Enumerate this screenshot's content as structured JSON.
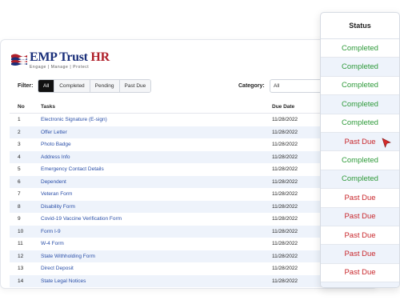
{
  "brand": {
    "name": "EMP Trust ",
    "name_accent": "HR",
    "tagline": "Engage | Manage | Protect"
  },
  "filter": {
    "label": "Filter:",
    "options": [
      "All",
      "Completed",
      "Pending",
      "Past Due"
    ],
    "active": "All"
  },
  "category": {
    "label": "Category:",
    "value": "All"
  },
  "table": {
    "headers": {
      "no": "No",
      "task": "Tasks",
      "due": "Due Date"
    },
    "rows": [
      {
        "no": "1",
        "task": "Electronic Signature (E-sign)",
        "due": "11/28/2022"
      },
      {
        "no": "2",
        "task": "Offer Letter",
        "due": "11/28/2022"
      },
      {
        "no": "3",
        "task": "Photo Badge",
        "due": "11/28/2022"
      },
      {
        "no": "4",
        "task": "Address Info",
        "due": "11/28/2022"
      },
      {
        "no": "5",
        "task": "Emergency Contact Details",
        "due": "11/28/2022"
      },
      {
        "no": "6",
        "task": "Dependent",
        "due": "11/28/2022"
      },
      {
        "no": "7",
        "task": "Veteran Form",
        "due": "11/28/2022"
      },
      {
        "no": "8",
        "task": "Disability Form",
        "due": "11/28/2022"
      },
      {
        "no": "9",
        "task": "Covid-19 Vaccine Verification Form",
        "due": "11/28/2022"
      },
      {
        "no": "10",
        "task": "Form I-9",
        "due": "11/28/2022"
      },
      {
        "no": "11",
        "task": "W-4 Form",
        "due": "11/28/2022"
      },
      {
        "no": "12",
        "task": "State Withholding Form",
        "due": "11/28/2022"
      },
      {
        "no": "13",
        "task": "Direct Deposit",
        "due": "11/28/2022"
      },
      {
        "no": "14",
        "task": "State Legal Notices",
        "due": "11/28/2022"
      }
    ]
  },
  "status_panel": {
    "header": "Status",
    "values": [
      "Completed",
      "Completed",
      "Completed",
      "Completed",
      "Completed",
      "Past Due",
      "Completed",
      "Completed",
      "Past Due",
      "Past Due",
      "Past Due",
      "Past Due",
      "Past Due",
      "Past Due"
    ]
  },
  "colors": {
    "completed": "#2e9a3a",
    "past_due": "#c8262b",
    "link": "#2a4fa8",
    "row_alt": "#eef3fb"
  }
}
